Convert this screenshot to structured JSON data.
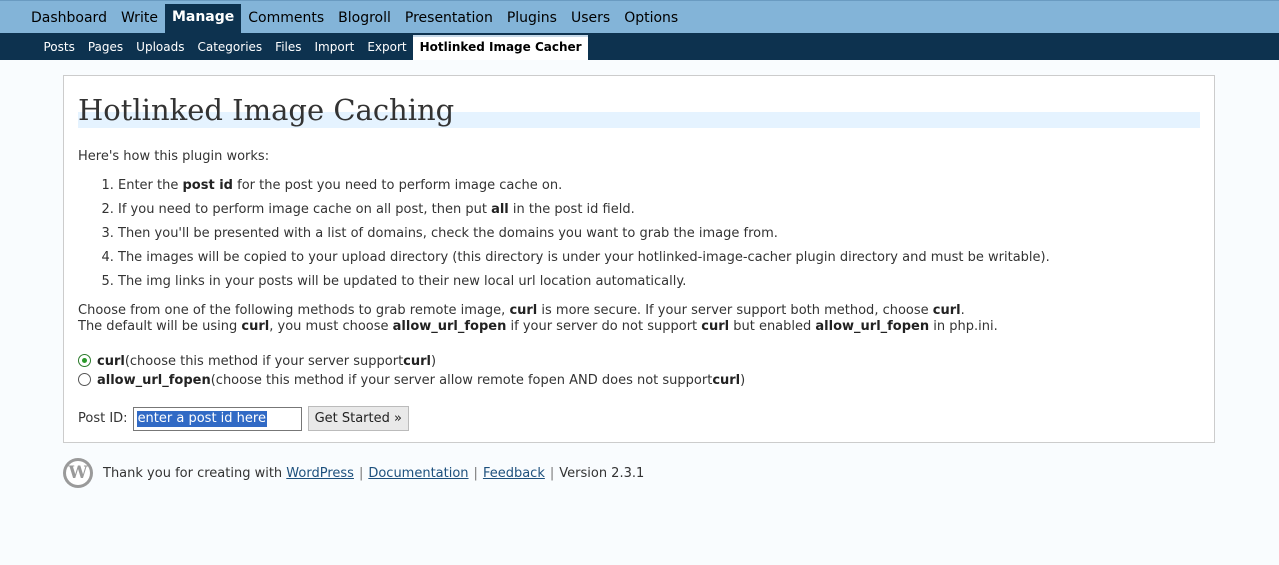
{
  "menu": [
    "Dashboard",
    "Write",
    "Manage",
    "Comments",
    "Blogroll",
    "Presentation",
    "Plugins",
    "Users",
    "Options"
  ],
  "menu_current": "Manage",
  "submenu": [
    "Posts",
    "Pages",
    "Uploads",
    "Categories",
    "Files",
    "Import",
    "Export",
    "Hotlinked Image Cacher"
  ],
  "submenu_current": "Hotlinked Image Cacher",
  "page": {
    "title": "Hotlinked Image Caching",
    "intro": "Here's how this plugin works:",
    "steps": [
      {
        "pre": "Enter the ",
        "bold": "post id",
        "post": " for the post you need to perform image cache on."
      },
      {
        "pre": "If you need to perform image cache on all post, then put ",
        "bold": "all",
        "post": " in the post id field."
      },
      {
        "pre": "Then you'll be presented with a list of domains, check the domains you want to grab the image from.",
        "bold": "",
        "post": ""
      },
      {
        "pre": "The images will be copied to your upload directory (this directory is under your hotlinked-image-cacher plugin directory and must be writable).",
        "bold": "",
        "post": ""
      },
      {
        "pre": "The img links in your posts will be updated to their new local url location automatically.",
        "bold": "",
        "post": ""
      }
    ],
    "methods_line1": {
      "a": "Choose from one of the following methods to grab remote image, ",
      "b": "curl",
      "c": " is more secure. If your server support both method, choose ",
      "d": "curl",
      "e": "."
    },
    "methods_line2": {
      "a": "The default will be using ",
      "b": "curl",
      "c": ", you must choose ",
      "d": "allow_url_fopen",
      "e": " if your server do not support ",
      "f": "curl",
      "g": " but enabled ",
      "h": "allow_url_fopen",
      "i": " in php.ini."
    },
    "radio_curl": {
      "name": "curl",
      "desc_pre": " (choose this method if your server support ",
      "desc_bold": "curl",
      "desc_post": ")",
      "checked": true
    },
    "radio_fopen": {
      "name": "allow_url_fopen",
      "desc_pre": " (choose this method if your server allow remote fopen AND does not support ",
      "desc_bold": "curl",
      "desc_post": ")",
      "checked": false
    },
    "postid_label": "Post ID:",
    "postid_value": "enter a post id here",
    "button": "Get Started »"
  },
  "footer": {
    "logo_letter": "W",
    "thanks": "Thank you for creating with ",
    "wordpress": "WordPress",
    "documentation": "Documentation",
    "feedback": "Feedback",
    "sep": "|",
    "version": "Version 2.3.1"
  }
}
